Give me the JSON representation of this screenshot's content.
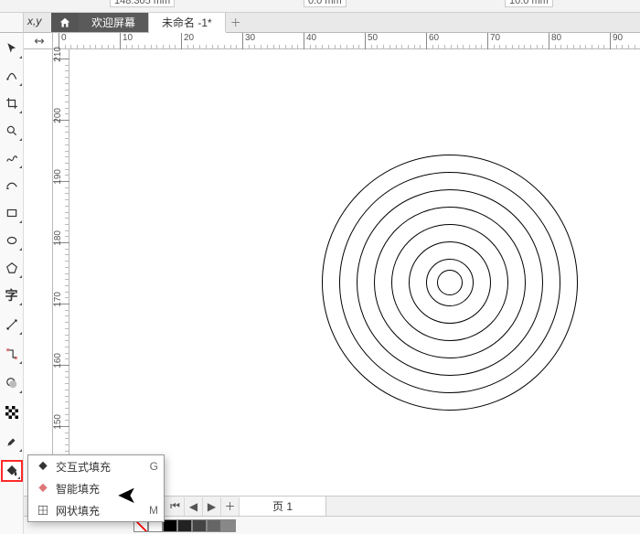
{
  "top_readouts": {
    "a": "148.305 mm",
    "b": "0.0 mm",
    "c": "10.0 mm"
  },
  "tabs": {
    "xy_label": "x,y",
    "welcome": "欢迎屏幕",
    "current": "未命名 -1*"
  },
  "ruler_h": [
    "0",
    "10",
    "20",
    "30",
    "40",
    "50",
    "60",
    "70",
    "80",
    "90"
  ],
  "ruler_v": [
    "210",
    "200",
    "190",
    "180",
    "170",
    "160",
    "150"
  ],
  "circles_radii": [
    140,
    121,
    102,
    83,
    64,
    45,
    26,
    14
  ],
  "flyout": {
    "items": [
      {
        "label": "交互式填充",
        "key": "G",
        "icon": "fill-interactive"
      },
      {
        "label": "智能填充",
        "key": "",
        "icon": "fill-smart"
      },
      {
        "label": "网状填充",
        "key": "M",
        "icon": "fill-mesh"
      }
    ]
  },
  "status": {
    "page_label": "页 1"
  },
  "palette": [
    "#ffffff",
    "#000000",
    "#222222",
    "#444444",
    "#666666",
    "#888888"
  ]
}
